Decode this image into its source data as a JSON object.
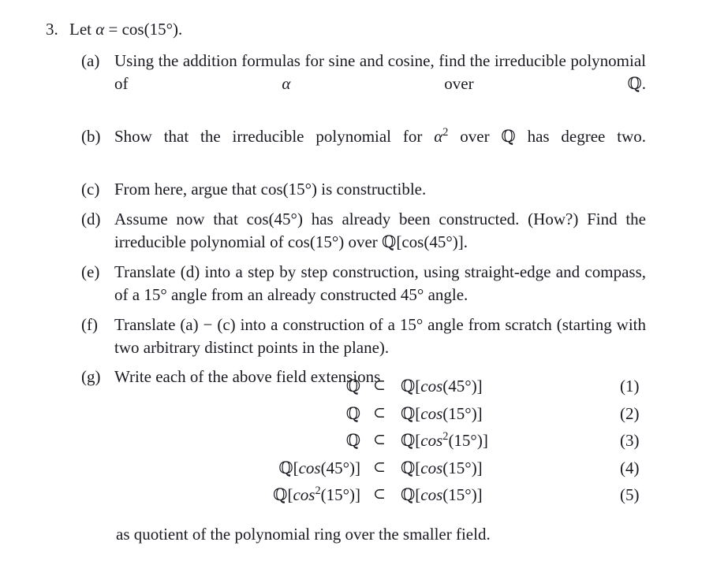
{
  "document": {
    "type": "math-exercise",
    "background_color": "#ffffff",
    "text_color": "#1a1a22"
  },
  "problem": {
    "number": "3.",
    "statement_prefix": "Let ",
    "alpha": "α",
    "equals": " = ",
    "value": "cos(15°).",
    "full_text": "3. Let α = cos(15°)."
  },
  "items": [
    {
      "label": "(a)",
      "text": "Using the addition formulas for sine and cosine, find the irreducible polynomial of α over ℚ.",
      "justified": true
    },
    {
      "label": "(b)",
      "text": "Show that the irreducible polynomial for α² over ℚ has degree two.",
      "justified": true
    },
    {
      "label": "(c)",
      "text": "From here, argue that cos(15°) is constructible.",
      "justified": false
    },
    {
      "label": "(d)",
      "text": "Assume now that cos(45°) has already been constructed. (How?) Find the irreducible polynomial of cos(15°) over ℚ[cos(45°)].",
      "justified": false
    },
    {
      "label": "(e)",
      "text": "Translate (d) into a step by step construction, using straight-edge and compass, of a 15° angle from an already constructed 45° angle.",
      "justified": false
    },
    {
      "label": "(f)",
      "text": "Translate (a) − (c) into a construction of a 15° angle from scratch (starting with two arbitrary distinct points in the plane).",
      "justified": false
    },
    {
      "label": "(g)",
      "text": "Write each of the above field extensions",
      "justified": false
    }
  ],
  "equations": {
    "relation_symbol": "⊂",
    "rows": [
      {
        "lhs": "ℚ",
        "relation": "⊂",
        "rhs": "ℚ[cos(45°)]",
        "tag": "(1)"
      },
      {
        "lhs": "ℚ",
        "relation": "⊂",
        "rhs": "ℚ[cos(15°)]",
        "tag": "(2)"
      },
      {
        "lhs": "ℚ",
        "relation": "⊂",
        "rhs": "ℚ[cos²(15°)]",
        "tag": "(3)"
      },
      {
        "lhs": "ℚ[cos(45°)]",
        "relation": "⊂",
        "rhs": "ℚ[cos(15°)]",
        "tag": "(4)"
      },
      {
        "lhs": "ℚ[cos²(15°)]",
        "relation": "⊂",
        "rhs": "ℚ[cos(15°)]",
        "tag": "(5)"
      }
    ]
  },
  "closing": {
    "text": "as quotient of the polynomial ring over the smaller field."
  }
}
